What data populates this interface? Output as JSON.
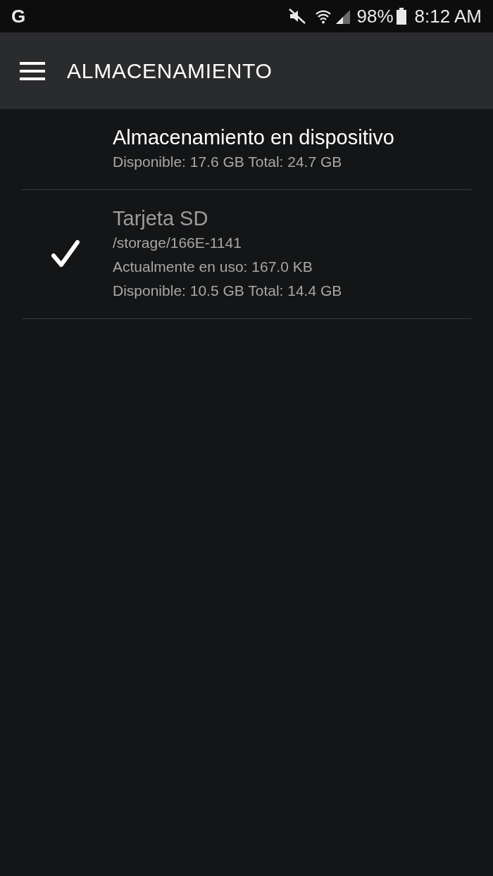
{
  "status_bar": {
    "logo": "G",
    "battery": "98%",
    "time": "8:12 AM"
  },
  "app_bar": {
    "title": "ALMACENAMIENTO"
  },
  "storage_options": [
    {
      "title": "Almacenamiento en dispositivo",
      "selected": false,
      "details": [
        "Disponible: 17.6 GB Total: 24.7 GB"
      ]
    },
    {
      "title": "Tarjeta SD",
      "selected": true,
      "details": [
        "/storage/166E-1141",
        "Actualmente en uso: 167.0 KB",
        "Disponible: 10.5 GB Total: 14.4 GB"
      ]
    }
  ]
}
